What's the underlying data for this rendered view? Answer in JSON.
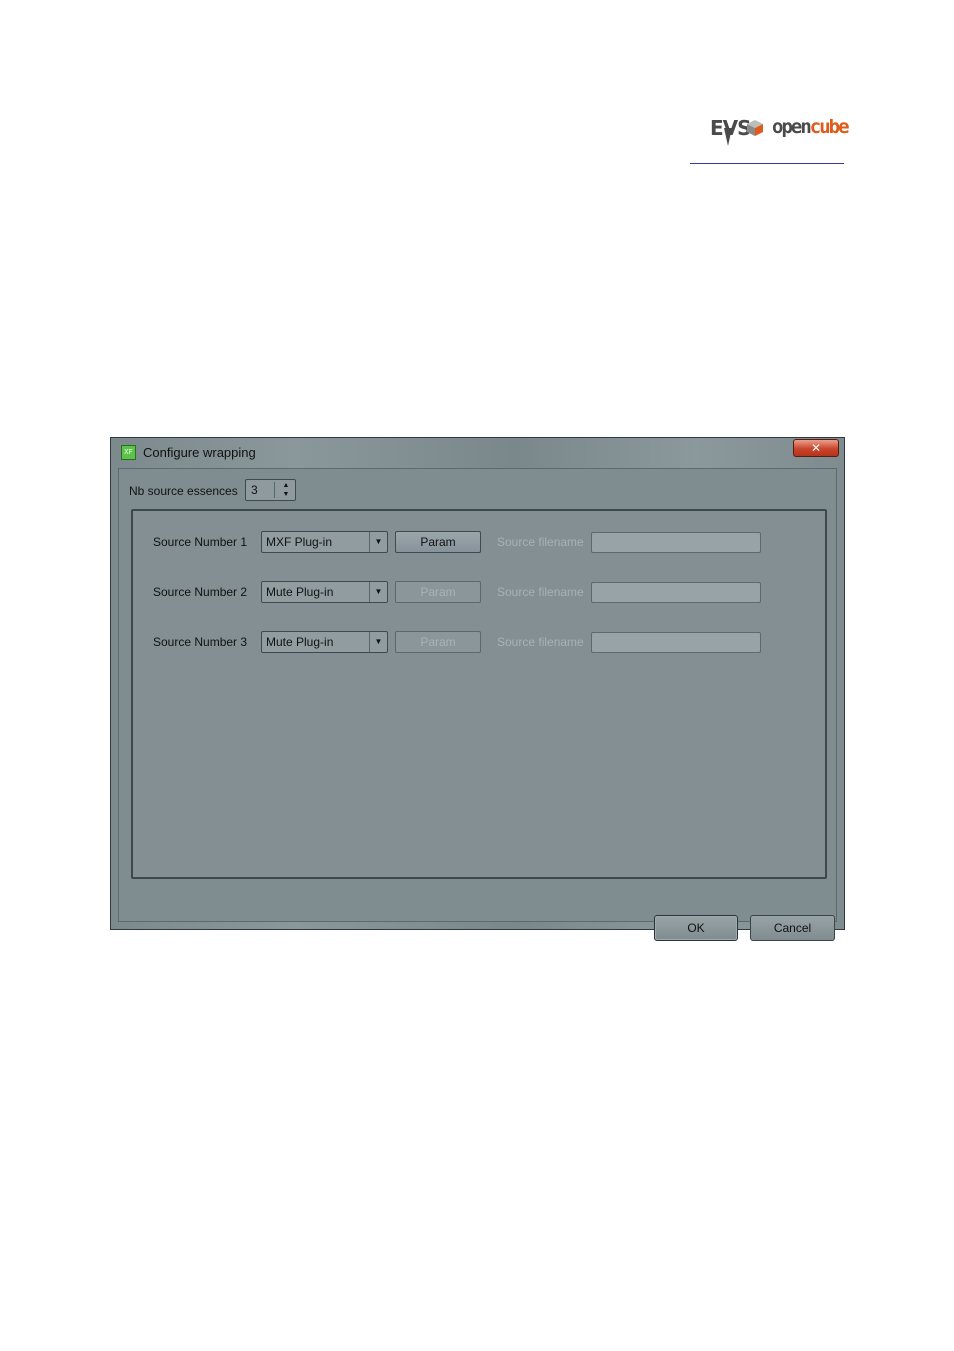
{
  "logo": {
    "brand": "EVS",
    "text_main": "open",
    "text_accent": "cube",
    "accent_color": "#e05a1a"
  },
  "dialog": {
    "title": "Configure wrapping",
    "app_icon_text": "XF",
    "close_glyph": "✕",
    "nb_source_label": "Nb source essences",
    "nb_source_value": "3",
    "rows": [
      {
        "label": "Source Number 1",
        "plugin": "MXF Plug-in",
        "param": "Param",
        "param_enabled": true,
        "filename_label": "Source filename",
        "filename_value": ""
      },
      {
        "label": "Source Number 2",
        "plugin": "Mute Plug-in",
        "param": "Param",
        "param_enabled": false,
        "filename_label": "Source filename",
        "filename_value": ""
      },
      {
        "label": "Source Number 3",
        "plugin": "Mute Plug-in",
        "param": "Param",
        "param_enabled": false,
        "filename_label": "Source filename",
        "filename_value": ""
      }
    ],
    "ok_label": "OK",
    "cancel_label": "Cancel"
  }
}
